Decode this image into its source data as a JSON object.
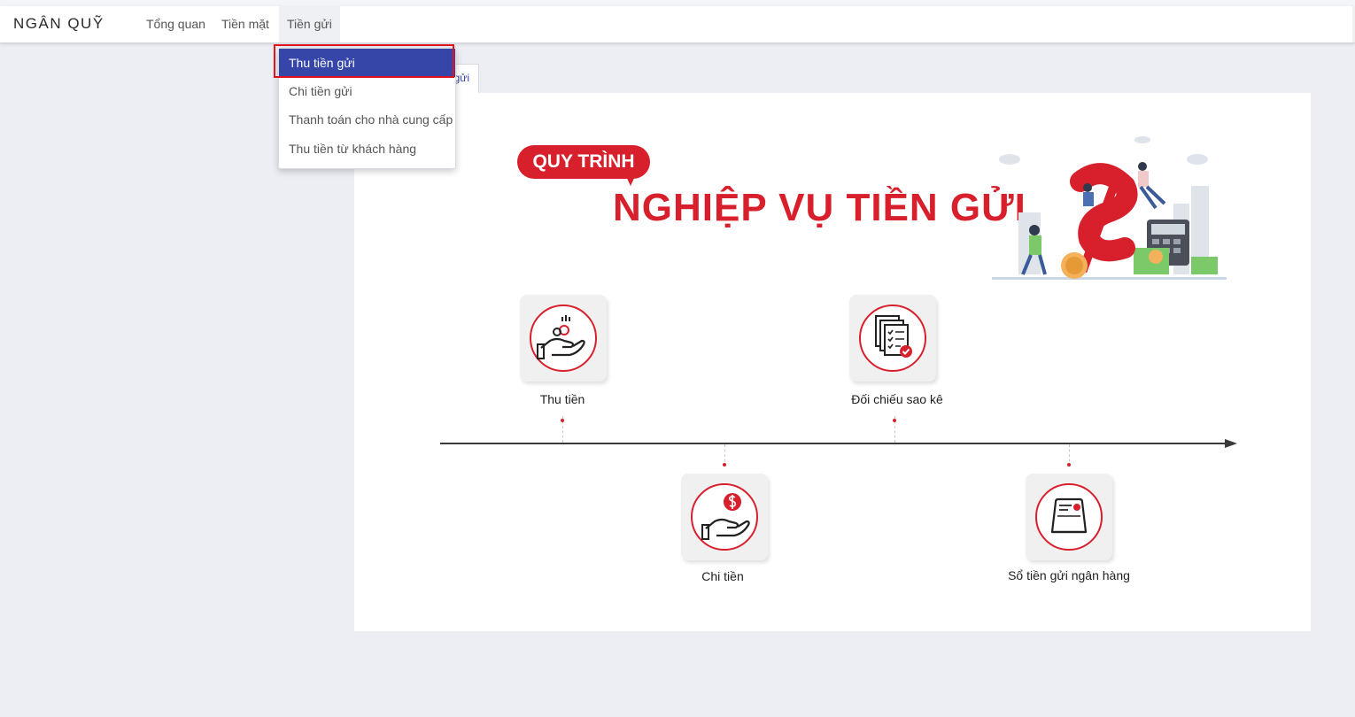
{
  "navbar": {
    "brand": "NGÂN QUỸ",
    "items": [
      {
        "label": "Tổng quan"
      },
      {
        "label": "Tiền mặt"
      },
      {
        "label": "Tiền gửi"
      }
    ]
  },
  "dropdown": {
    "items": [
      {
        "label": "Thu tiền gửi",
        "selected": true
      },
      {
        "label": "Chi tiền gửi"
      },
      {
        "label": "Thanh toán cho nhà cung cấp"
      },
      {
        "label": "Thu tiền từ khách hàng"
      }
    ]
  },
  "tab": {
    "label_fragment": "gửi"
  },
  "diagram": {
    "badge": "QUY TRÌNH",
    "title": "NGHIỆP VỤ TIỀN GỬI",
    "steps": [
      {
        "label": "Thu tiền",
        "icon": "hand-coins-icon"
      },
      {
        "label": "Chi tiền",
        "icon": "hand-dollar-icon"
      },
      {
        "label": "Đối chiếu sao kê",
        "icon": "documents-check-icon"
      },
      {
        "label": "Sổ tiền gửi ngân hàng",
        "icon": "bankbook-icon"
      }
    ]
  },
  "colors": {
    "accent": "#d8202d",
    "primary": "#3545a8"
  }
}
